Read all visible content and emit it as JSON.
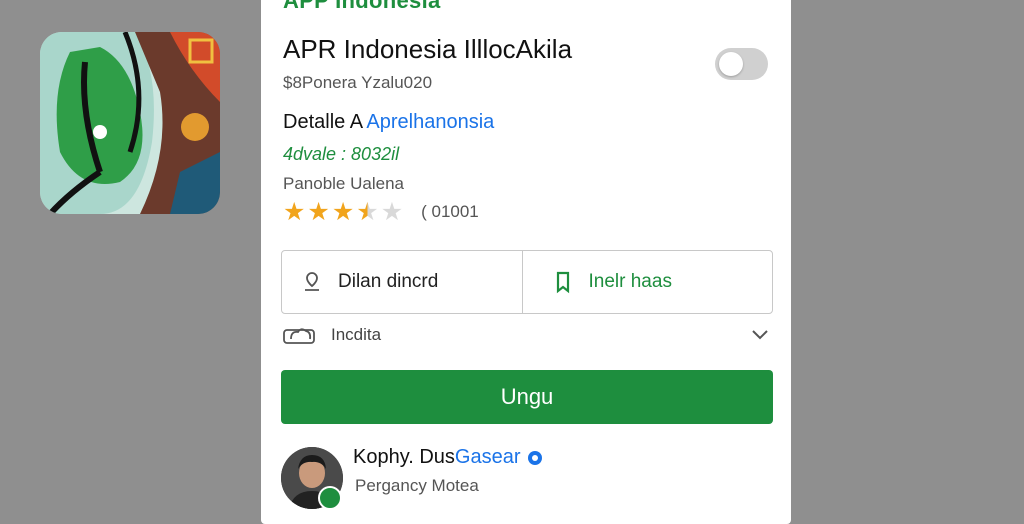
{
  "app": {
    "top_title": "APP Indonesia",
    "name": "APR Indonesia IlllocAkila",
    "publisher": "$8Ponera Yzalu020",
    "detail_prefix": "Detalle A",
    "detail_link": "Aprelhanonsia",
    "meta_green": "4dvale : 8032il",
    "category": "Panoble Ualena",
    "rating": 3.5,
    "rating_max": 5,
    "rating_count": "( 01001",
    "toggle_on": false
  },
  "actions": {
    "left_label": "Dilan dincrd",
    "right_label": "Inelr haas",
    "info_label": "Incdita",
    "primary_label": "Ungu"
  },
  "developer": {
    "name_prefix": "Kophy. Dus",
    "name_accent": "Gasear",
    "subtitle": "Pergancy Motea"
  },
  "colors": {
    "accent_green": "#1e8e3e",
    "link_blue": "#1a73e8",
    "star": "#f1a41c",
    "background": "#8f8f8f"
  },
  "icons": [
    "app-icon",
    "toggle",
    "star-icon",
    "pin-icon",
    "bookmark-icon",
    "cloud-icon",
    "chevron-down-icon",
    "verified-icon"
  ]
}
